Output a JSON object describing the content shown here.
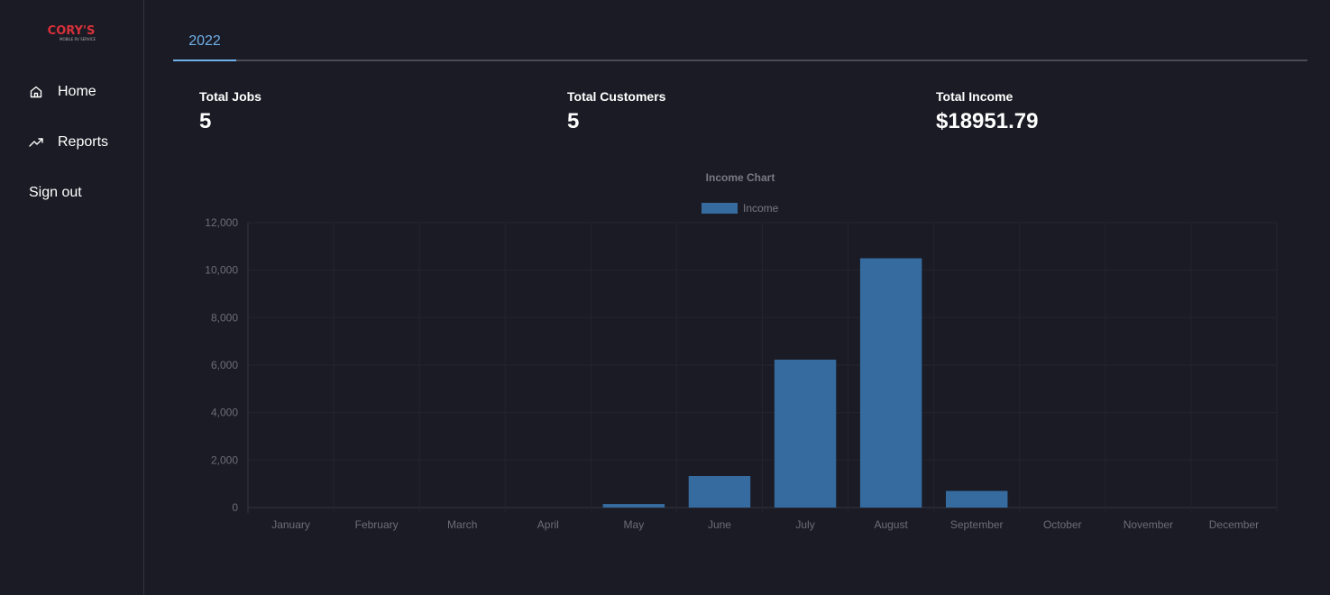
{
  "sidebar": {
    "logo_text": "CORY'S",
    "logo_subtext": "MOBILE RV SERVICE",
    "items": [
      {
        "label": "Home",
        "icon": "home-icon"
      },
      {
        "label": "Reports",
        "icon": "trending-up-icon"
      },
      {
        "label": "Sign out"
      }
    ]
  },
  "tabs": [
    {
      "label": "2022",
      "active": true
    }
  ],
  "stats": {
    "total_jobs": {
      "label": "Total Jobs",
      "value": "5"
    },
    "total_customers": {
      "label": "Total Customers",
      "value": "5"
    },
    "total_income": {
      "label": "Total Income",
      "value": "$18951.79"
    }
  },
  "colors": {
    "background": "#1b1b25",
    "accent": "#6fb0e8",
    "bar": "#356b9f",
    "logo_red": "#d8313a"
  },
  "chart_data": {
    "type": "bar",
    "title": "Income Chart",
    "categories": [
      "January",
      "February",
      "March",
      "April",
      "May",
      "June",
      "July",
      "August",
      "September",
      "October",
      "November",
      "December"
    ],
    "series": [
      {
        "name": "Income",
        "values": [
          0,
          0,
          0,
          0,
          150,
          1330,
          6230,
          10500,
          700,
          0,
          0,
          0
        ]
      }
    ],
    "ylim": [
      0,
      12000
    ],
    "yticks": [
      "0",
      "2,000",
      "4,000",
      "6,000",
      "8,000",
      "10,000",
      "12,000"
    ],
    "ytick_values": [
      0,
      2000,
      4000,
      6000,
      8000,
      10000,
      12000
    ],
    "grid": true,
    "legend": "top-center"
  }
}
